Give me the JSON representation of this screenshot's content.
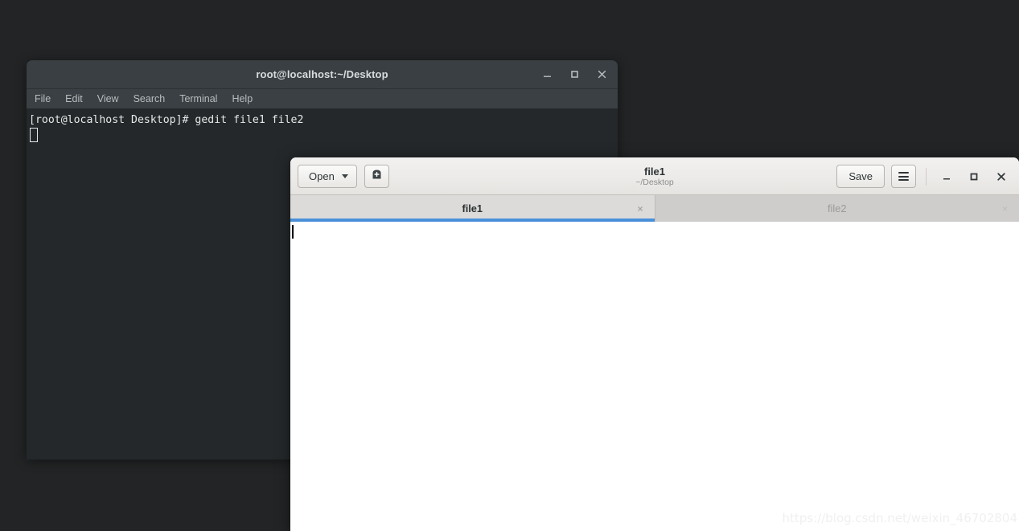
{
  "desktop": {
    "background_color": "#222425"
  },
  "terminal": {
    "title": "root@localhost:~/Desktop",
    "titlebar_color": "#393f42",
    "body_color": "#24282a",
    "controls": [
      {
        "name": "minimize",
        "glyph": "minimize-icon"
      },
      {
        "name": "maximize",
        "glyph": "maximize-icon"
      },
      {
        "name": "close",
        "glyph": "close-icon"
      }
    ],
    "menu": [
      "File",
      "Edit",
      "View",
      "Search",
      "Terminal",
      "Help"
    ],
    "lines": [
      "[root@localhost Desktop]# gedit file1 file2"
    ]
  },
  "gedit": {
    "title": "file1",
    "subtitle": "~/Desktop",
    "open_label": "Open",
    "save_label": "Save",
    "new_doc_icon": "new-document-icon",
    "menu_icon": "hamburger-menu-icon",
    "accent_color": "#4a90d9",
    "header_color": "#eceae8",
    "controls": [
      {
        "name": "minimize",
        "glyph": "minimize-icon"
      },
      {
        "name": "maximize",
        "glyph": "maximize-icon"
      },
      {
        "name": "close",
        "glyph": "close-icon"
      }
    ],
    "tabs": [
      {
        "label": "file1",
        "active": true,
        "close": "×"
      },
      {
        "label": "file2",
        "active": false,
        "close": "×"
      }
    ],
    "editor": {
      "content": ""
    }
  },
  "watermark": {
    "text": "https://blog.csdn.net/weixin_46702804"
  }
}
